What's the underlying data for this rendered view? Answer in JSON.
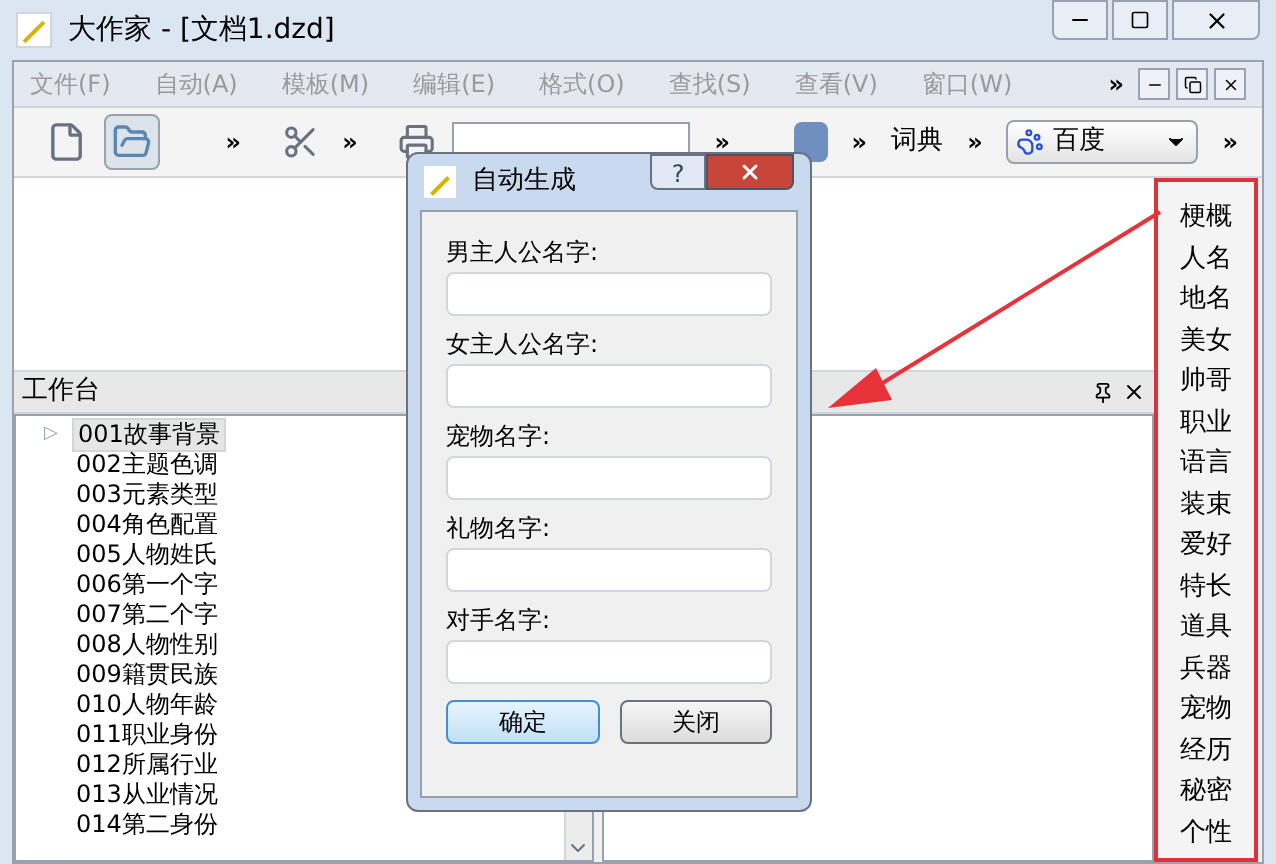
{
  "window": {
    "title": "大作家 - [文档1.dzd]"
  },
  "menu": [
    "文件(F)",
    "自动(A)",
    "模板(M)",
    "编辑(E)",
    "格式(O)",
    "查找(S)",
    "查看(V)",
    "窗口(W)"
  ],
  "menu_overflow": "»",
  "toolbar": {
    "overflow": "»",
    "dictionary": "词典",
    "search_engine": "百度"
  },
  "workbench": {
    "title": "工作台",
    "items": [
      {
        "label": "001故事背景",
        "selected": true,
        "expander": "▷"
      },
      {
        "label": "002主题色调",
        "selected": false
      },
      {
        "label": "003元素类型",
        "selected": false
      },
      {
        "label": "004角色配置",
        "selected": false
      },
      {
        "label": "005人物姓氏",
        "selected": false
      },
      {
        "label": "006第一个字",
        "selected": false
      },
      {
        "label": "007第二个字",
        "selected": false
      },
      {
        "label": "008人物性别",
        "selected": false
      },
      {
        "label": "009籍贯民族",
        "selected": false
      },
      {
        "label": "010人物年龄",
        "selected": false
      },
      {
        "label": "011职业身份",
        "selected": false
      },
      {
        "label": "012所属行业",
        "selected": false
      },
      {
        "label": "013从业情况",
        "selected": false
      },
      {
        "label": "014第二身份",
        "selected": false
      }
    ]
  },
  "categories": [
    "梗概",
    "人名",
    "地名",
    "美女",
    "帅哥",
    "职业",
    "语言",
    "装束",
    "爱好",
    "特长",
    "道具",
    "兵器",
    "宠物",
    "经历",
    "秘密",
    "个性"
  ],
  "dialog": {
    "title": "自动生成",
    "help": "?",
    "fields": [
      {
        "label": "男主人公名字:"
      },
      {
        "label": "女主人公名字:"
      },
      {
        "label": "宠物名字:"
      },
      {
        "label": "礼物名字:"
      },
      {
        "label": "对手名字:"
      }
    ],
    "buttons": [
      {
        "label": "确定",
        "default": true
      },
      {
        "label": "关闭",
        "default": false
      }
    ]
  }
}
